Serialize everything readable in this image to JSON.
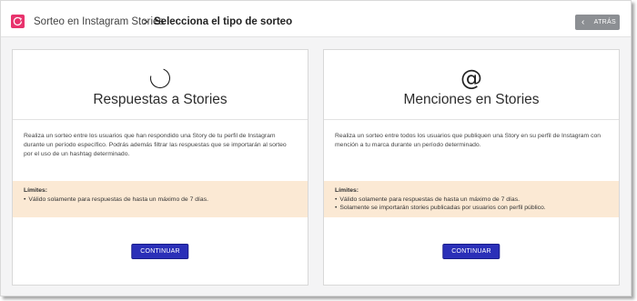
{
  "header": {
    "breadcrumb_link": "Sorteo en Instagram Stories",
    "breadcrumb_separator": ">",
    "breadcrumb_current": "Selecciona el tipo de sorteo",
    "back_label": "ATRÁS",
    "brand_color": "#e8336d"
  },
  "cards": [
    {
      "icon": "loading-circle-icon",
      "title": "Respuestas a Stories",
      "description": "Realiza un sorteo entre los usuarios que han respondido una Story de tu perfil de Instagram durante un período específico. Podrás además filtrar las respuestas que se importarán al sorteo por el uso de un hashtag determinado.",
      "limits_title": "Límites:",
      "limits": [
        "Válido solamente para respuestas de hasta un máximo de 7 días."
      ],
      "button_label": "CONTINUAR"
    },
    {
      "icon": "at-sign-icon",
      "title": "Menciones en Stories",
      "description": "Realiza un sorteo entre todos los usuarios que publiquen una Story en su perfil de Instagram con mención a tu marca durante un período determinado.",
      "limits_title": "Límites:",
      "limits": [
        "Válido solamente para respuestas de hasta un máximo de 7 días.",
        "Solamente se importarán stories publicadas por usuarios con perfil público."
      ],
      "button_label": "CONTINUAR"
    }
  ],
  "colors": {
    "button": "#2a2fb8",
    "limits_bg": "#fbe9d4",
    "back_button": "#8c8f93"
  }
}
